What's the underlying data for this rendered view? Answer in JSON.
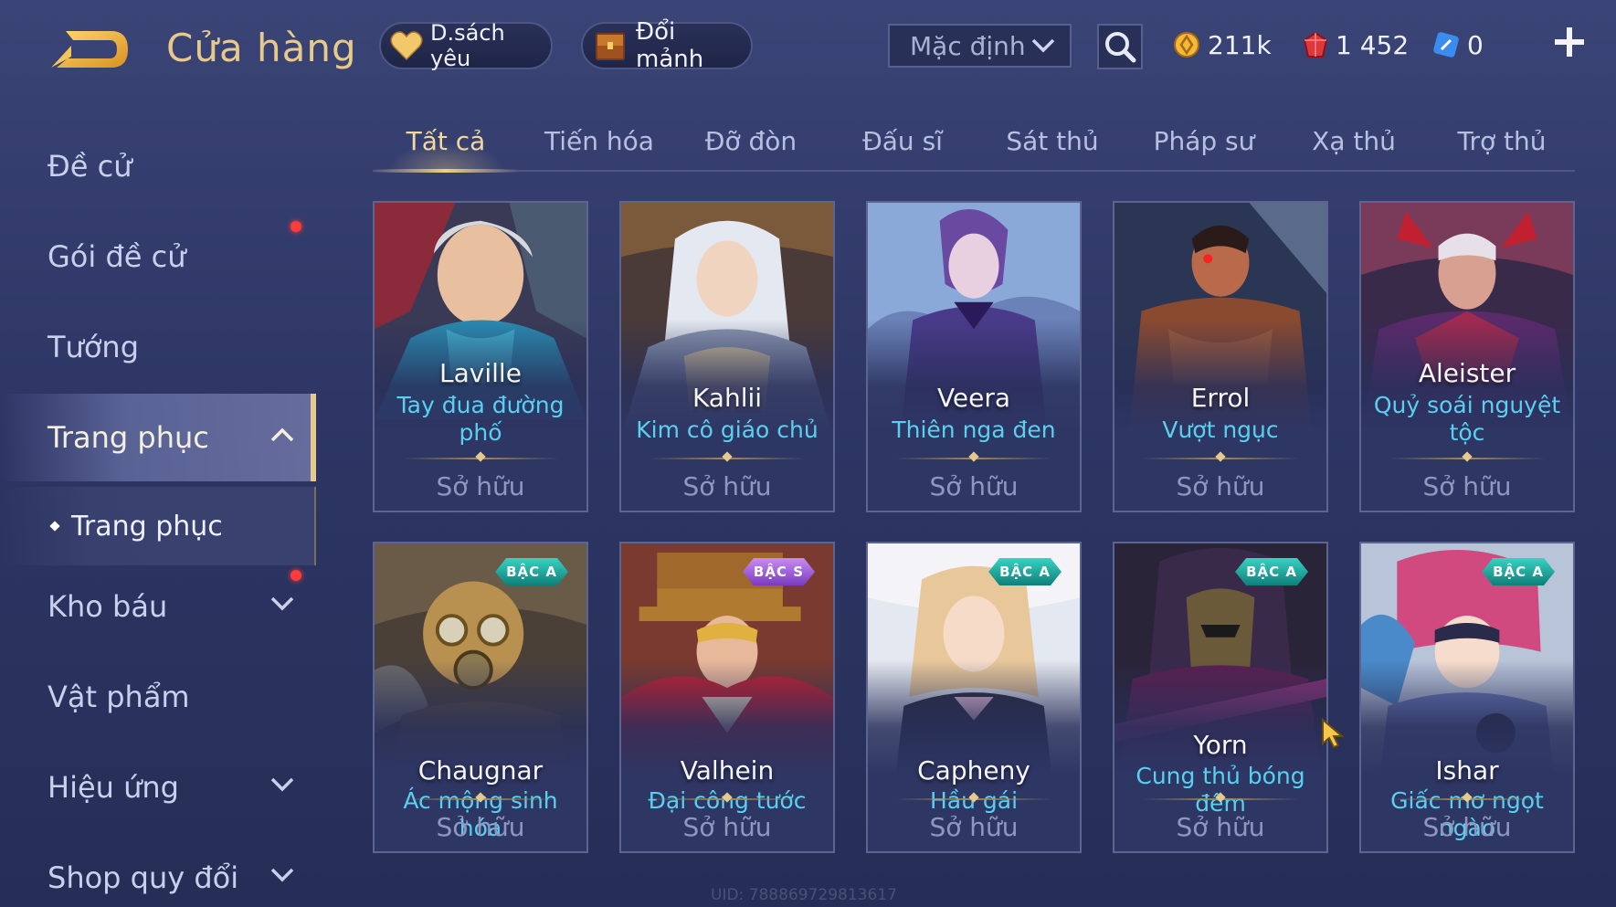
{
  "header": {
    "title": "Cửa hàng",
    "favorites_label": "D.sách yêu",
    "exchange_label": "Đổi mảnh",
    "sort_label": "Mặc định",
    "currencies": {
      "gold": "211k",
      "ruby": "1 452",
      "voucher": "0"
    }
  },
  "sidebar": {
    "items": [
      {
        "label": "Đề cử"
      },
      {
        "label": "Gói đề cử"
      },
      {
        "label": "Tướng"
      },
      {
        "label": "Trang phục"
      },
      {
        "label": "Kho báu"
      },
      {
        "label": "Vật phẩm"
      },
      {
        "label": "Hiệu ứng"
      },
      {
        "label": "Shop quy đổi"
      }
    ],
    "sub_item": "Trang phục"
  },
  "tabs": [
    {
      "label": "Tất cả"
    },
    {
      "label": "Tiến hóa"
    },
    {
      "label": "Đỡ đòn"
    },
    {
      "label": "Đấu sĩ"
    },
    {
      "label": "Sát thủ"
    },
    {
      "label": "Pháp sư"
    },
    {
      "label": "Xạ thủ"
    },
    {
      "label": "Trợ thủ"
    }
  ],
  "cards": [
    {
      "hero": "Laville",
      "skin": "Tay đua đường phố",
      "status": "Sở hữu",
      "badge": ""
    },
    {
      "hero": "Kahlii",
      "skin": "Kim cô giáo chủ",
      "status": "Sở hữu",
      "badge": ""
    },
    {
      "hero": "Veera",
      "skin": "Thiên nga đen",
      "status": "Sở hữu",
      "badge": ""
    },
    {
      "hero": "Errol",
      "skin": "Vượt ngục",
      "status": "Sở hữu",
      "badge": ""
    },
    {
      "hero": "Aleister",
      "skin": "Quỷ soái nguyệt tộc",
      "status": "Sở hữu",
      "badge": ""
    },
    {
      "hero": "Chaugnar",
      "skin": "Ác mộng sinh hóa",
      "status": "Sở hữu",
      "badge": "BẬC A"
    },
    {
      "hero": "Valhein",
      "skin": "Đại công tước",
      "status": "Sở hữu",
      "badge": "BẬC S"
    },
    {
      "hero": "Capheny",
      "skin": "Hầu gái",
      "status": "Sở hữu",
      "badge": "BẬC A"
    },
    {
      "hero": "Yorn",
      "skin": "Cung thủ bóng đêm",
      "status": "Sở hữu",
      "badge": "BẬC A"
    },
    {
      "hero": "Ishar",
      "skin": "Giấc mơ ngọt ngào",
      "status": "Sở hữu",
      "badge": "BẬC A"
    }
  ],
  "uid_text": "UID: 788869729813617",
  "colors": {
    "accent_gold": "#e6c98c",
    "skin_name": "#5ad0f0",
    "badge_a": "#1aa39a",
    "badge_s": "#9a55d8",
    "notify": "#ff3b3b"
  },
  "icons": {
    "back": "back-arrow-icon",
    "favorites": "heart-icon",
    "exchange": "chest-icon",
    "search": "search-icon",
    "gold": "gold-coin-icon",
    "ruby": "ruby-gem-icon",
    "voucher": "voucher-icon",
    "plus": "plus-icon"
  }
}
